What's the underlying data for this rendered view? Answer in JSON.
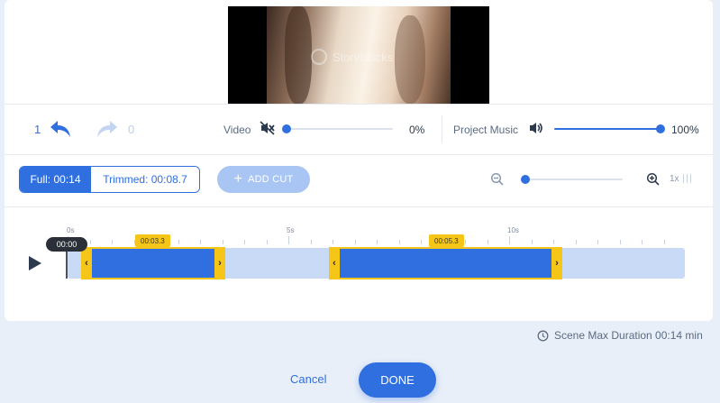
{
  "preview": {
    "watermark": "Storyblocks"
  },
  "history": {
    "undo_count": "1",
    "redo_count": "0"
  },
  "video": {
    "label": "Video",
    "volume_text": "0%",
    "volume": 0
  },
  "music": {
    "label": "Project Music",
    "volume_text": "100%",
    "volume": 1.0
  },
  "duration_toggle": {
    "full_label": "Full: 00:14",
    "trimmed_label": "Trimmed: 00:08.7",
    "selected": "full"
  },
  "add_cut": {
    "label": "ADD CUT"
  },
  "zoom": {
    "label": "1x",
    "level": 0.0
  },
  "ruler": {
    "labels": [
      "0s",
      "5s",
      "10s"
    ]
  },
  "playhead": {
    "time": "00:00"
  },
  "clips": [
    {
      "duration": "00:03.3"
    },
    {
      "duration": "00:05.3"
    }
  ],
  "footer": {
    "max_duration": "Scene Max Duration 00:14 min",
    "cancel_label": "Cancel",
    "done_label": "DONE"
  },
  "colors": {
    "accent": "#2f6fe0",
    "handle": "#f5c518",
    "timeline": "#c8daf6"
  }
}
